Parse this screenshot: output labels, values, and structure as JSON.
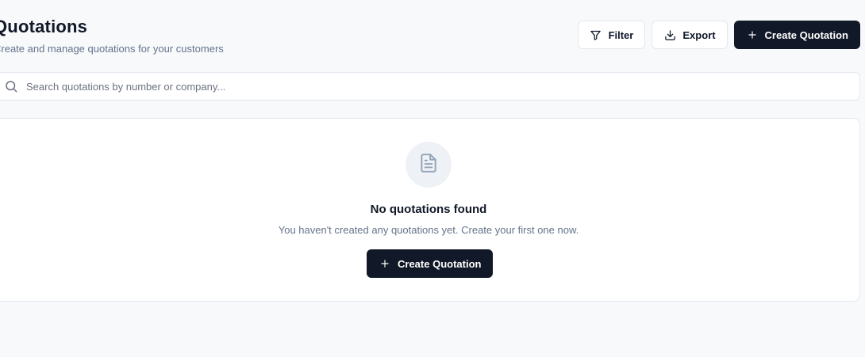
{
  "header": {
    "title": "Quotations",
    "subtitle": "Create and manage quotations for your customers"
  },
  "toolbar": {
    "filter_label": "Filter",
    "export_label": "Export",
    "create_label": "Create Quotation"
  },
  "search": {
    "placeholder": "Search quotations by number or company...",
    "value": ""
  },
  "empty_state": {
    "title": "No quotations found",
    "description": "You haven't created any quotations yet. Create your first one now.",
    "button_label": "Create Quotation",
    "icon": "file-text-icon"
  },
  "colors": {
    "background": "#f8f9fb",
    "primary": "#111827",
    "muted_text": "#64748b",
    "border": "#e2e8f0"
  }
}
